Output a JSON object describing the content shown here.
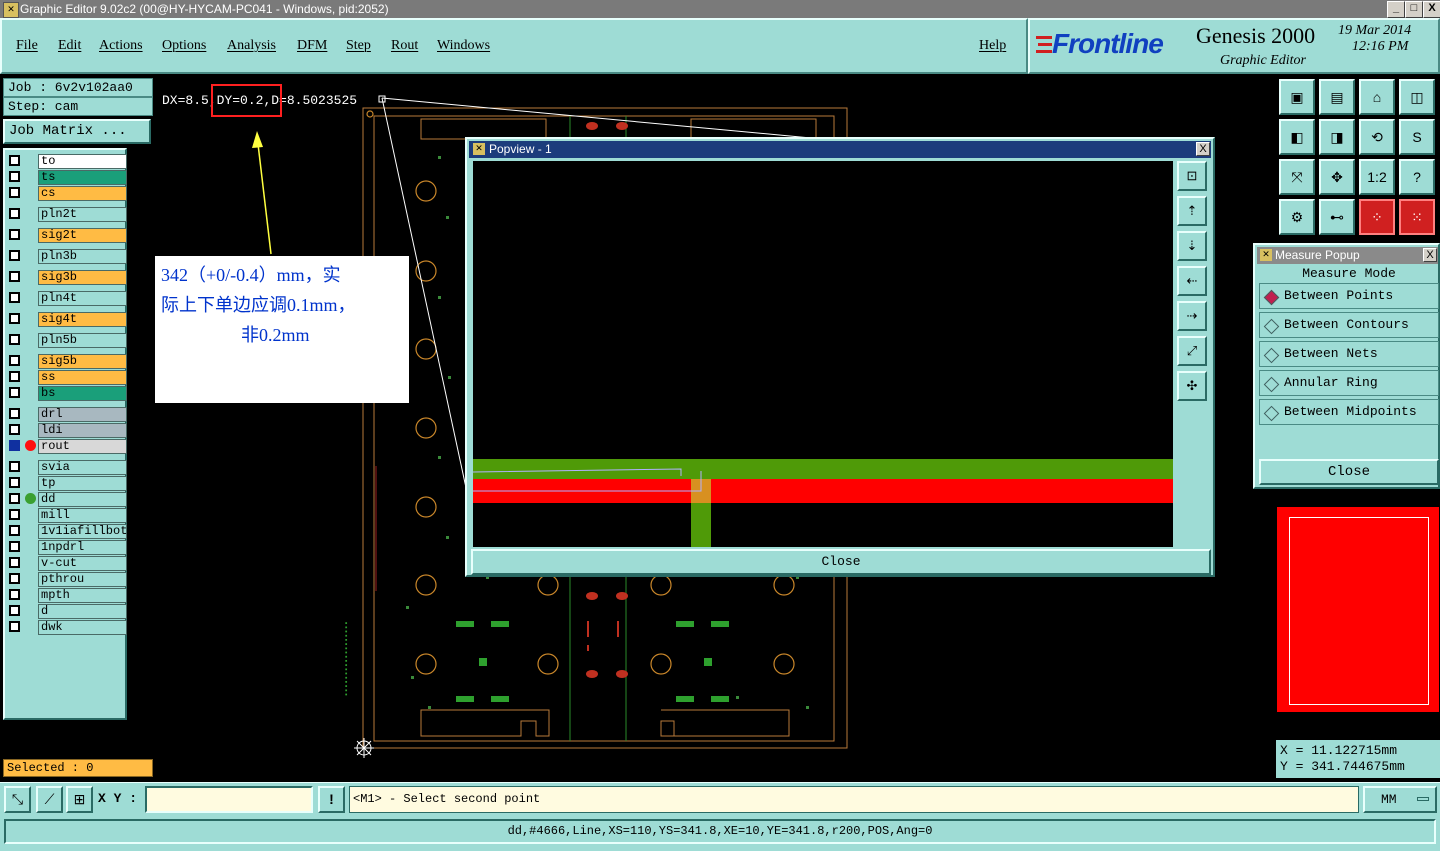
{
  "window": {
    "title": "Graphic Editor 9.02c2 (00@HY-HYCAM-PC041 - Windows, pid:2052)",
    "min_label": "_",
    "max_label": "□",
    "close_label": "X"
  },
  "menu": {
    "items": [
      "File",
      "Edit",
      "Actions",
      "Options",
      "Analysis",
      "DFM",
      "Step",
      "Rout",
      "Windows"
    ],
    "help": "Help"
  },
  "brand": {
    "logo": "Frontline",
    "product": "Genesis 2000",
    "subtitle": "Graphic Editor",
    "date": "19 Mar 2014",
    "time": "12:16 PM"
  },
  "job": {
    "job_label": "Job :  6v2v102aa0",
    "step_label": "Step:  cam",
    "matrix_button": "Job Matrix ..."
  },
  "layers": [
    {
      "name": "to",
      "color": "#ffffff"
    },
    {
      "name": "ts",
      "color": "#1a9f7a"
    },
    {
      "name": "cs",
      "color": "#ffbb44"
    },
    {
      "name": "pln2t",
      "color": "#9edcd5"
    },
    {
      "name": "sig2t",
      "color": "#ffbb44"
    },
    {
      "name": "pln3b",
      "color": "#9edcd5"
    },
    {
      "name": "sig3b",
      "color": "#ffbb44"
    },
    {
      "name": "pln4t",
      "color": "#9edcd5"
    },
    {
      "name": "sig4t",
      "color": "#ffbb44"
    },
    {
      "name": "pln5b",
      "color": "#9edcd5"
    },
    {
      "name": "sig5b",
      "color": "#ffbb44"
    },
    {
      "name": "ss",
      "color": "#ffbb44"
    },
    {
      "name": "bs",
      "color": "#1a9f7a"
    },
    {
      "name": "drl",
      "color": "#a8b8c0"
    },
    {
      "name": "ldi",
      "color": "#a8b8c0"
    },
    {
      "name": "rout",
      "color": "#d8d8d8"
    },
    {
      "name": "svia",
      "color": "#9edcd5"
    },
    {
      "name": "tp",
      "color": "#9edcd5"
    },
    {
      "name": "dd",
      "color": "#9edcd5"
    },
    {
      "name": "mill",
      "color": "#9edcd5"
    },
    {
      "name": "1v1iafillbot",
      "color": "#9edcd5"
    },
    {
      "name": "1npdrl",
      "color": "#9edcd5"
    },
    {
      "name": "v-cut",
      "color": "#9edcd5"
    },
    {
      "name": "pthrou",
      "color": "#9edcd5"
    },
    {
      "name": "mpth",
      "color": "#9edcd5"
    },
    {
      "name": "d",
      "color": "#9edcd5"
    },
    {
      "name": "dwk",
      "color": "#9edcd5"
    }
  ],
  "selected": "Selected : 0",
  "measure_readout": {
    "dx": "DX=8.5",
    "dy": "DY=0.2",
    "d": "D=8.5023525"
  },
  "annotation": {
    "line1": "342（+0/-0.4）mm，实",
    "line2": "际上下单边应调0.1mm，",
    "line3": "非0.2mm"
  },
  "popview": {
    "title": "Popview - 1",
    "close": "Close",
    "close_x": "X",
    "side_buttons": [
      "zoom-home",
      "pan-up",
      "pan-down",
      "pan-left",
      "pan-right",
      "zoom-in",
      "zoom-out"
    ]
  },
  "measure_popup": {
    "title": "Measure Popup",
    "mode_label": "Measure Mode",
    "options": [
      "Between Points",
      "Between Contours",
      "Between Nets",
      "Annular Ring",
      "Between Midpoints"
    ],
    "selected": "Between Points",
    "close": "Close",
    "close_x": "X"
  },
  "coords": {
    "x": "X =  11.122715mm",
    "y": "Y =  341.744675mm"
  },
  "bottom": {
    "xy_label": "X Y :",
    "xy_value": "",
    "prompt": "<M1> - Select second point",
    "units": "MM",
    "status": "dd,#4666,Line,XS=110,YS=341.8,XE=10,YE=341.8,r200,POS,Ang=0"
  },
  "toolbar_icons": [
    "zoom-fit-icon",
    "zoom-out-icon",
    "home-icon",
    "split-view-icon",
    "pan-left-icon",
    "pan-right-icon",
    "rotate-icon",
    "snap-icon",
    "fit-all-icon",
    "center-icon",
    "ratio-icon",
    "help-icon",
    "tools-icon",
    "measure-icon",
    "layers-icon",
    "net-icon"
  ],
  "toolbar_labels": [
    "▣",
    "▤",
    "⌂",
    "◫",
    "◧",
    "◨",
    "⟲",
    "S",
    "⤧",
    "✥",
    "1:2",
    "?",
    "⚙",
    "⊷",
    "⁘",
    "⁙"
  ]
}
